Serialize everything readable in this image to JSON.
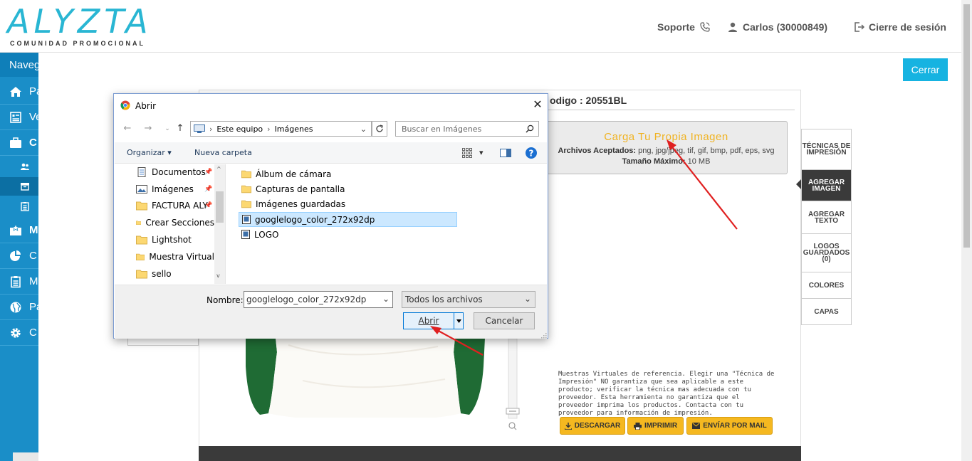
{
  "header": {
    "logo_text": "ALYZTA",
    "logo_sub": "COMUNIDAD PROMOCIONAL",
    "support": "Soporte",
    "user": "Carlos (30000849)",
    "logout": "Cierre de sesión"
  },
  "sidebar": {
    "heading": "Naveg",
    "items": [
      {
        "label": "Pa",
        "icon": "home-icon"
      },
      {
        "label": "Ve",
        "icon": "catalog-icon"
      },
      {
        "label": "C",
        "icon": "briefcase-icon"
      },
      {
        "label": "M",
        "icon": "star-box-icon"
      },
      {
        "label": "C",
        "icon": "pie-chart-icon"
      },
      {
        "label": "M",
        "icon": "clipboard-icon"
      },
      {
        "label": "Pa",
        "icon": "globe-icon"
      },
      {
        "label": "C",
        "icon": "gear-icon"
      }
    ]
  },
  "page": {
    "close_button": "Cerrar",
    "code_label": "odigo : 20551BL",
    "upload_title": "Carga Tu Propia Imagen",
    "accepted_label": "Archivos Aceptados:",
    "accepted_values": " png, jpg/jpeg, tif, gif, bmp, pdf, eps, svg ",
    "max_label": "Tamaño Máximo:",
    "max_value": " 10 MB",
    "tabs": [
      "TÉCNICAS DE IMPRESIÓN",
      "AGREGAR IMAGEN",
      "AGREGAR TEXTO",
      "LOGOS GUARDADOS (0)",
      "COLORES",
      "CAPAS"
    ],
    "notice": "Muestras Virtuales de referencia. Elegir una \"Técnica de Impresión\" NO garantiza que sea aplicable a este producto; verificar la técnica mas adecuada con tu proveedor. Esta herramienta no garantiza que el proveedor imprima los productos. Contacta con tu proveedor para información de impresión.",
    "buttons": {
      "download": "DESCARGAR",
      "print": "IMPRIMIR",
      "mail": "ENVÍAR POR MAIL"
    }
  },
  "dialog": {
    "title": "Abrir",
    "breadcrumb": [
      "Este equipo",
      "Imágenes"
    ],
    "search_placeholder": "Buscar en Imágenes",
    "organize": "Organizar",
    "new_folder": "Nueva carpeta",
    "nav_items": [
      {
        "label": "Documentos",
        "icon": "documents-icon",
        "pinned": true
      },
      {
        "label": "Imágenes",
        "icon": "pictures-icon",
        "pinned": true
      },
      {
        "label": "FACTURA ALY",
        "icon": "folder-icon",
        "pinned": true
      },
      {
        "label": "Crear Secciones",
        "icon": "folder-icon",
        "pinned": false
      },
      {
        "label": "Lightshot",
        "icon": "folder-icon",
        "pinned": false
      },
      {
        "label": "Muestra Virtual",
        "icon": "folder-icon",
        "pinned": false
      },
      {
        "label": "sello",
        "icon": "folder-icon",
        "pinned": false
      }
    ],
    "files": [
      {
        "label": "Álbum de cámara",
        "icon": "folder-icon"
      },
      {
        "label": "Capturas de pantalla",
        "icon": "folder-icon"
      },
      {
        "label": "Imágenes guardadas",
        "icon": "folder-icon"
      },
      {
        "label": "googlelogo_color_272x92dp",
        "icon": "image-file-icon",
        "selected": true
      },
      {
        "label": "LOGO",
        "icon": "image-file-icon"
      }
    ],
    "filename_label": "Nombre:",
    "filename_value": "googlelogo_color_272x92dp",
    "filetype": "Todos los archivos",
    "open": "Abrir",
    "cancel": "Cancelar"
  },
  "colors": {
    "accent": "#16b3e1",
    "sidebar": "#1a8ec8",
    "upload_title": "#f0b322",
    "action": "#f5b820",
    "arrow": "#e02020"
  }
}
